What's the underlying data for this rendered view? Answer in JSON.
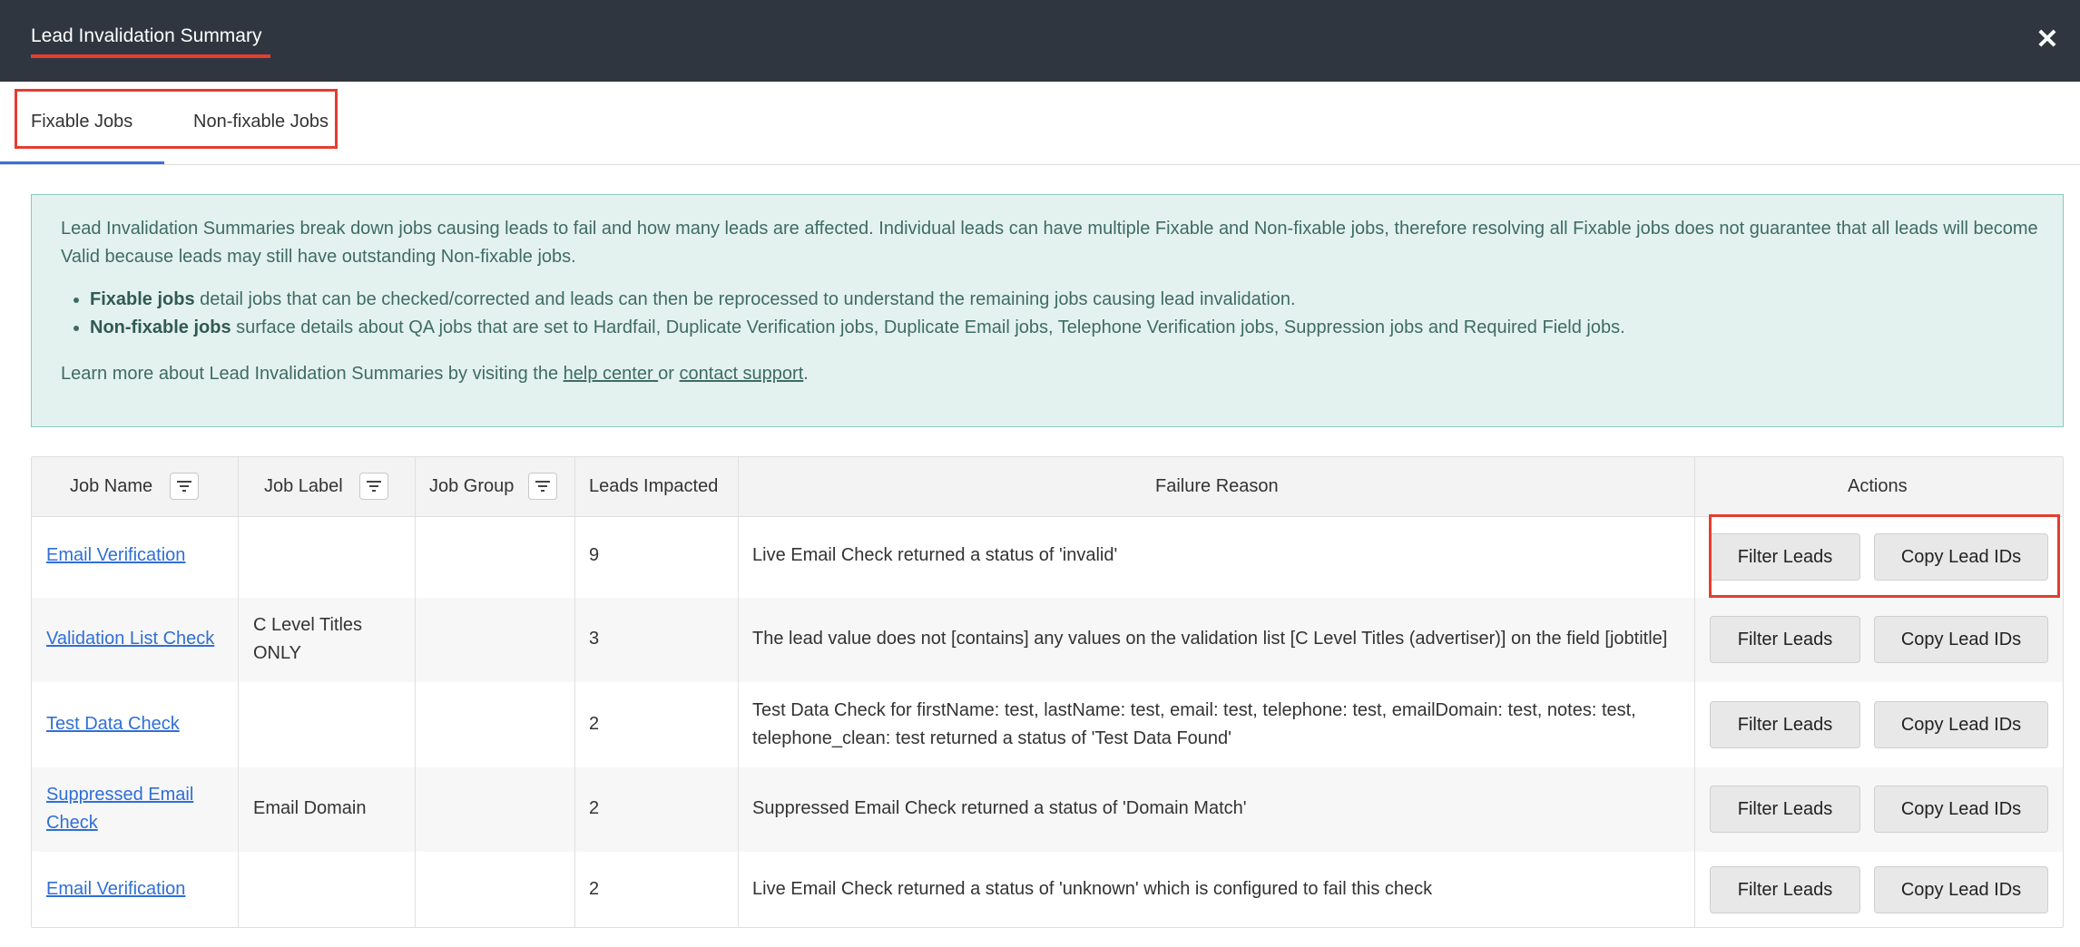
{
  "dialog": {
    "title": "Lead Invalidation Summary"
  },
  "tabs": [
    {
      "label": "Fixable Jobs"
    },
    {
      "label": "Non-fixable Jobs"
    }
  ],
  "info": {
    "description": "Lead Invalidation Summaries break down jobs causing leads to fail and how many leads are affected. Individual leads can have multiple Fixable and Non-fixable jobs, therefore resolving all Fixable jobs does not guarantee that all leads will become Valid because leads may still have outstanding Non-fixable jobs.",
    "bullets": [
      {
        "term": "Fixable jobs",
        "text": " detail jobs that can be checked/corrected and leads can then be reprocessed to understand the remaining jobs causing lead invalidation."
      },
      {
        "term": "Non-fixable jobs",
        "text": " surface details about QA jobs that are set to Hardfail, Duplicate Verification jobs, Duplicate Email jobs, Telephone Verification jobs, Suppression jobs and Required Field jobs."
      }
    ],
    "learn_prefix": "Learn more about Lead Invalidation Summaries by visiting the ",
    "help_center": "help center ",
    "or": "or ",
    "contact_support": "contact support",
    "period": "."
  },
  "table": {
    "columns": {
      "job_name": "Job Name",
      "job_label": "Job Label",
      "job_group": "Job Group",
      "leads_impacted": "Leads Impacted",
      "failure_reason": "Failure Reason",
      "actions": "Actions"
    },
    "rows": [
      {
        "job_name": "Email Verification",
        "job_label": "",
        "job_group": "",
        "leads": "9",
        "reason": "Live Email Check returned a status of 'invalid'"
      },
      {
        "job_name": "Validation List Check",
        "job_label": "C Level Titles ONLY",
        "job_group": "",
        "leads": "3",
        "reason": "The lead value does not [contains] any values on the validation list [C Level Titles (advertiser)] on the field [jobtitle]"
      },
      {
        "job_name": "Test Data Check",
        "job_label": "",
        "job_group": "",
        "leads": "2",
        "reason": "Test Data Check for firstName: test, lastName: test, email: test, telephone: test, emailDomain: test, notes: test, telephone_clean: test returned a status of 'Test Data Found'"
      },
      {
        "job_name": "Suppressed Email Check",
        "job_label": "Email Domain",
        "job_group": "",
        "leads": "2",
        "reason": "Suppressed Email Check returned a status of 'Domain Match'"
      },
      {
        "job_name": "Email Verification",
        "job_label": "",
        "job_group": "",
        "leads": "2",
        "reason": "Live Email Check returned a status of 'unknown' which is configured to fail this check"
      }
    ],
    "filter_leads_label": "Filter Leads",
    "copy_lead_ids_label": "Copy Lead IDs"
  }
}
